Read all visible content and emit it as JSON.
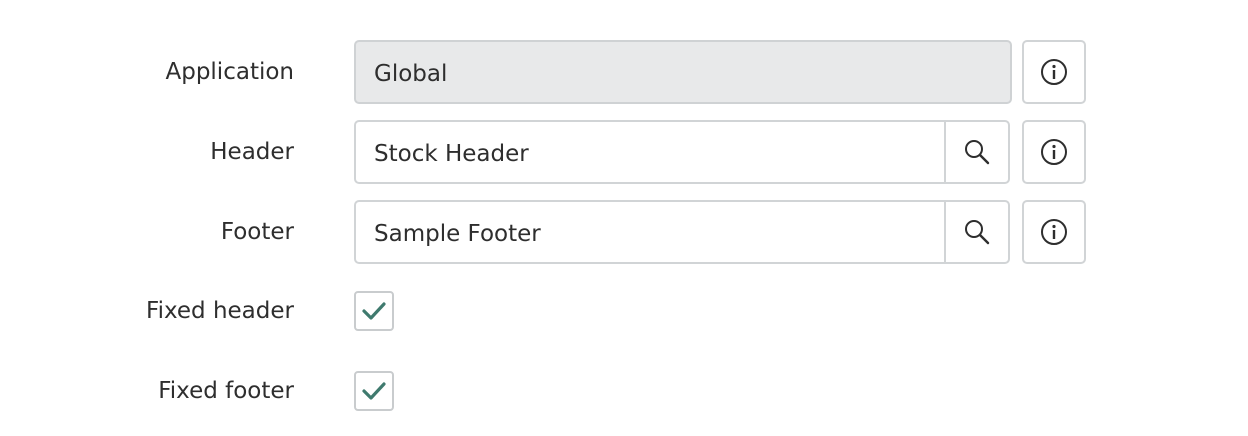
{
  "form": {
    "application": {
      "label": "Application",
      "value": "Global",
      "info_icon": "info-icon"
    },
    "header": {
      "label": "Header",
      "value": "Stock Header",
      "lookup_icon": "search-icon",
      "info_icon": "info-icon"
    },
    "footer": {
      "label": "Footer",
      "value": "Sample Footer",
      "lookup_icon": "search-icon",
      "info_icon": "info-icon"
    },
    "fixed_header": {
      "label": "Fixed header",
      "checked": true
    },
    "fixed_footer": {
      "label": "Fixed footer",
      "checked": true
    }
  },
  "colors": {
    "checkmark": "#3f7a6e",
    "readonly_bg": "#e8e9ea",
    "border": "#d1d4d6",
    "text": "#2e2e2e"
  }
}
